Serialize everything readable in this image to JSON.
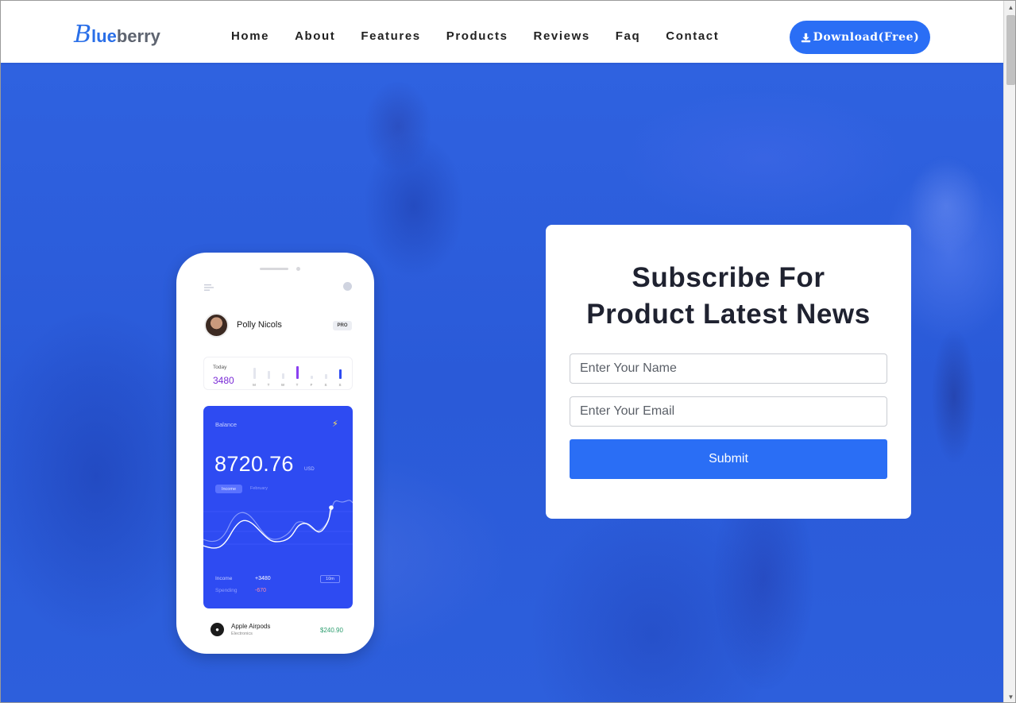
{
  "brand": {
    "logo_first": "B",
    "logo_blue": "lue",
    "logo_gray": "berry",
    "accent": "#2a6ef5"
  },
  "nav": {
    "items": [
      {
        "label": "Home"
      },
      {
        "label": "About"
      },
      {
        "label": "Features"
      },
      {
        "label": "Products"
      },
      {
        "label": "Reviews"
      },
      {
        "label": "Faq"
      },
      {
        "label": "Contact"
      }
    ],
    "download_label": "Download(Free)",
    "download_icon": "download-icon"
  },
  "phone": {
    "user_name": "Polly Nicols",
    "badge": "PRO",
    "today_label": "Today",
    "today_value": "3480",
    "days": [
      "M",
      "T",
      "W",
      "T",
      "F",
      "S",
      "S"
    ],
    "balance_label": "Balance",
    "balance_amount": "8720.76",
    "currency": "USD",
    "income_pill": "Income",
    "month": "February",
    "income_label": "Income",
    "income_value": "+3480",
    "spending_label": "Spending",
    "spending_value": "-670",
    "period": "10m",
    "item_name": "Apple Airpods",
    "item_category": "Electronics",
    "item_price": "$240.90"
  },
  "subscribe": {
    "title_line1": "Subscribe For",
    "title_line2": "Product Latest News",
    "name_placeholder": "Enter Your Name",
    "email_placeholder": "Enter Your Email",
    "submit_label": "Submit"
  }
}
